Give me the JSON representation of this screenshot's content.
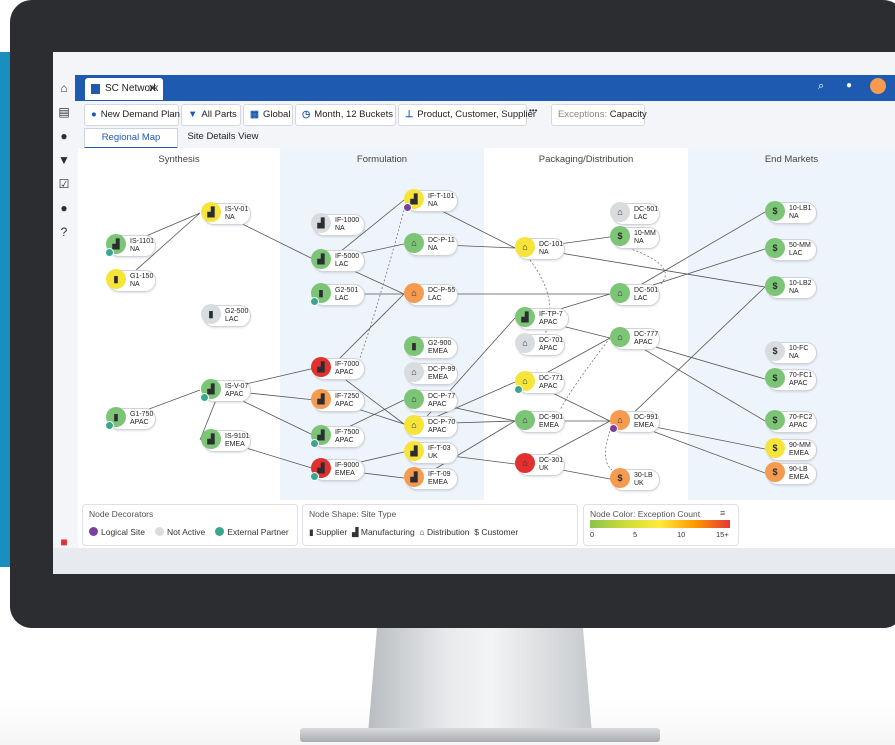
{
  "tab": {
    "label": "SC Network"
  },
  "toolbar": {
    "demand_plan": "New Demand Plan",
    "parts": "All Parts",
    "region": "Global",
    "time": "Month, 12 Buckets",
    "hierarchy": "Product, Customer, Supplier",
    "more": "•••",
    "exceptions_prefix": "Exceptions:",
    "exceptions_value": "Capacity"
  },
  "subtabs": {
    "regional_map": "Regional Map",
    "site_details": "Site Details View"
  },
  "columns": {
    "synthesis": "Synthesis",
    "formulation": "Formulation",
    "packaging": "Packaging/Distribution",
    "end_markets": "End Markets"
  },
  "nodes": {
    "is1101": {
      "id": "IS-1101",
      "region": "NA"
    },
    "g1150": {
      "id": "G1-150",
      "region": "NA"
    },
    "isv01": {
      "id": "IS-V-01",
      "region": "NA"
    },
    "g2500": {
      "id": "G2-500",
      "region": "LAC"
    },
    "g1750": {
      "id": "G1-750",
      "region": "APAC"
    },
    "isv07": {
      "id": "IS-V-07",
      "region": "APAC"
    },
    "is9101": {
      "id": "IS-9101",
      "region": "EMEA"
    },
    "if1000": {
      "id": "IF-1000",
      "region": "NA"
    },
    "if5000": {
      "id": "IF-5000",
      "region": "LAC"
    },
    "g2501": {
      "id": "G2-501",
      "region": "LAC"
    },
    "ift101": {
      "id": "IF-T-101",
      "region": "NA"
    },
    "dcp11": {
      "id": "DC-P-11",
      "region": "NA"
    },
    "dcp55": {
      "id": "DC-P-55",
      "region": "LAC"
    },
    "if7000": {
      "id": "IF-7000",
      "region": "APAC"
    },
    "if7250": {
      "id": "IF-7250",
      "region": "APAC"
    },
    "if7500": {
      "id": "IF-7500",
      "region": "APAC"
    },
    "if9000": {
      "id": "IF-9000",
      "region": "EMEA"
    },
    "g2900": {
      "id": "G2-900",
      "region": "EMEA"
    },
    "dcp99": {
      "id": "DC-P-99",
      "region": "EMEA"
    },
    "dcp77": {
      "id": "DC-P-77",
      "region": "APAC"
    },
    "dcp70": {
      "id": "DC-P-70",
      "region": "APAC"
    },
    "ift03": {
      "id": "IF-T-03",
      "region": "UK"
    },
    "ift09": {
      "id": "IF-T-09",
      "region": "EMEA"
    },
    "dc101": {
      "id": "DC-101",
      "region": "NA"
    },
    "dc501a": {
      "id": "DC-501",
      "region": "LAC"
    },
    "mm10": {
      "id": "10-MM",
      "region": "NA"
    },
    "dc501b": {
      "id": "DC-501",
      "region": "LAC"
    },
    "iftp7": {
      "id": "IF-TP-7",
      "region": "APAC"
    },
    "dc701": {
      "id": "DC-701",
      "region": "APAC"
    },
    "dc777": {
      "id": "DC-777",
      "region": "APAC"
    },
    "dc771": {
      "id": "DC-771",
      "region": "APAC"
    },
    "dc901": {
      "id": "DC-901",
      "region": "EMEA"
    },
    "dc991": {
      "id": "DC-991",
      "region": "EMEA"
    },
    "dc301": {
      "id": "DC-301",
      "region": "UK"
    },
    "lb30": {
      "id": "30-LB",
      "region": "UK"
    },
    "lb10": {
      "id": "10-LB1",
      "region": "NA"
    },
    "mm50": {
      "id": "50-MM",
      "region": "LAC"
    },
    "lb102": {
      "id": "10-LB2",
      "region": "NA"
    },
    "fc10": {
      "id": "10-FC",
      "region": "NA"
    },
    "fc701": {
      "id": "70-FC1",
      "region": "APAC"
    },
    "fc702": {
      "id": "70-FC2",
      "region": "APAC"
    },
    "mm90": {
      "id": "90-MM",
      "region": "EMEA"
    },
    "lb90": {
      "id": "90-LB",
      "region": "EMEA"
    }
  },
  "legend": {
    "decorators_title": "Node Decorators",
    "logical_site": "Logical Site",
    "not_active": "Not Active",
    "external_partner": "External Partner",
    "shape_title": "Node Shape: Site Type",
    "supplier": "Supplier",
    "manufacturing": "Manufacturing",
    "distribution": "Distribution",
    "customer": "Customer",
    "color_title": "Node Color: Exception Count",
    "scale": [
      "0",
      "5",
      "10",
      "15+"
    ]
  },
  "colors": {
    "green": "#7cc576",
    "yellow": "#f6e43a",
    "orange": "#f59a4e",
    "red": "#e0312f",
    "grey": "#d9dcdf",
    "purple": "#7b3fa0",
    "teal": "#3aa68e",
    "brand": "#1e5bb0"
  }
}
